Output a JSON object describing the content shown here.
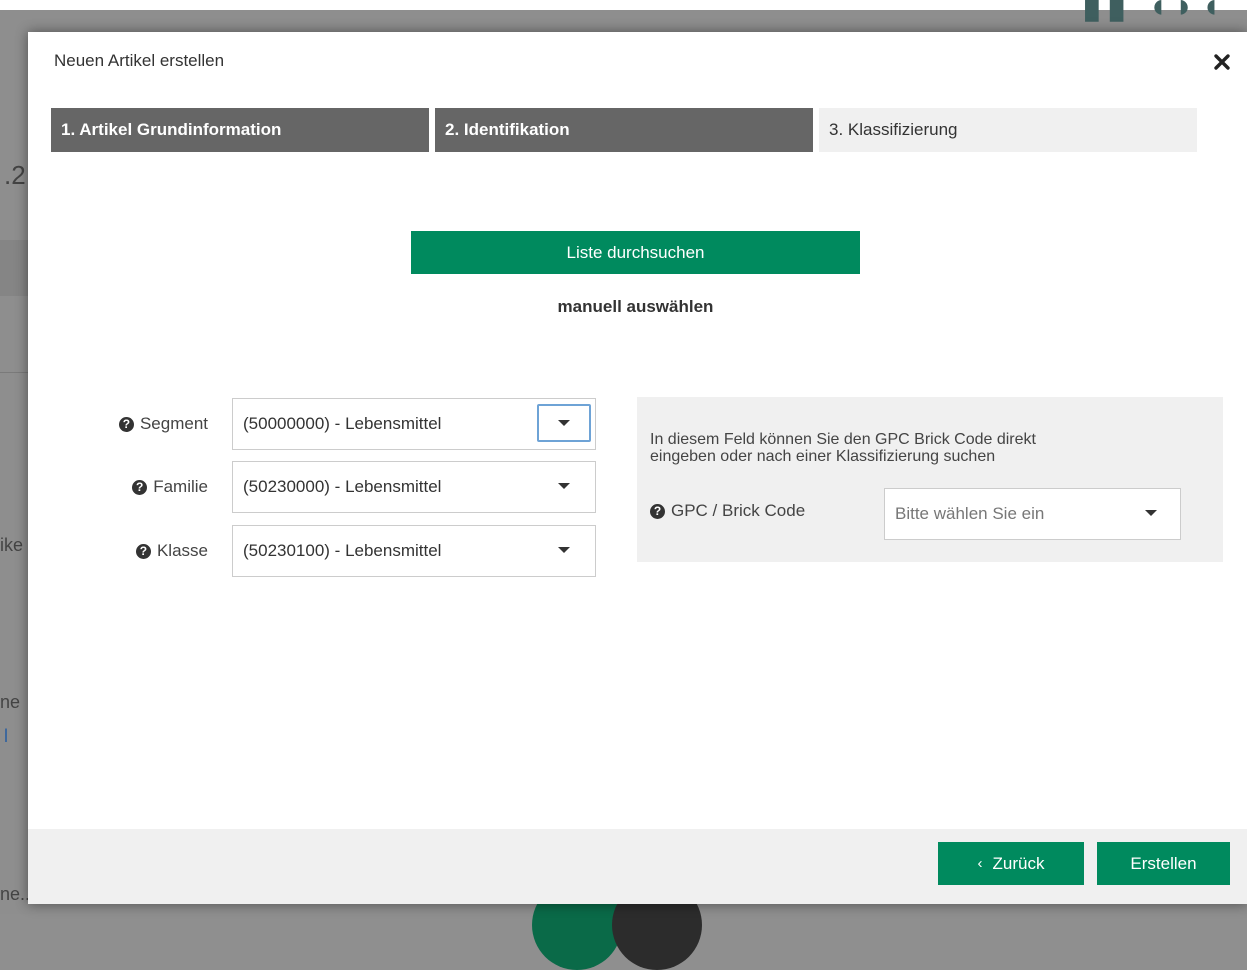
{
  "background": {
    "fragments": [
      ".2",
      "ike",
      "ne",
      "l",
      "ne..."
    ]
  },
  "modal": {
    "title": "Neuen Artikel erstellen",
    "close_icon": "close-icon"
  },
  "steps": [
    {
      "label": "1. Artikel Grundinformation",
      "state": "done"
    },
    {
      "label": "2. Identifikation",
      "state": "done"
    },
    {
      "label": "3. Klassifizierung",
      "state": "active"
    }
  ],
  "search_button_label": "Liste durchsuchen",
  "manual_select_label": "manuell auswählen",
  "fields": {
    "segment": {
      "label": "Segment",
      "value": "(50000000) - Lebensmittel"
    },
    "familie": {
      "label": "Familie",
      "value": "(50230000) - Lebensmittel"
    },
    "klasse": {
      "label": "Klasse",
      "value": "(50230100) - Lebensmittel"
    }
  },
  "gpc": {
    "info_line1": "In diesem Feld können Sie den GPC Brick Code direkt",
    "info_line2": "eingeben oder nach einer Klassifizierung suchen",
    "label": "GPC / Brick Code",
    "placeholder": "Bitte wählen Sie ein"
  },
  "footer": {
    "back_label": "Zurück",
    "create_label": "Erstellen"
  },
  "colors": {
    "primary": "#008a5e",
    "step_done": "#666666",
    "step_active": "#f0f0f0"
  }
}
